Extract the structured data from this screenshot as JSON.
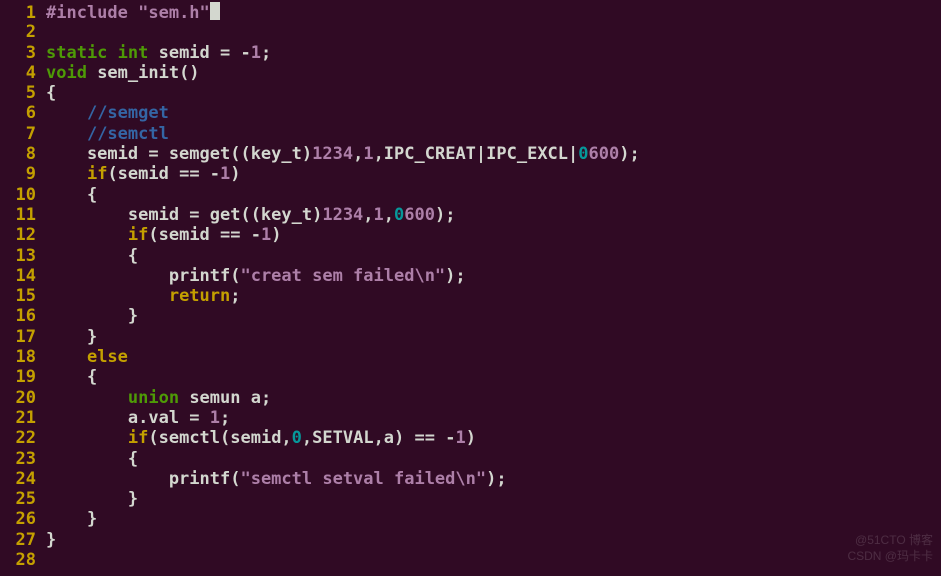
{
  "editor": {
    "lines": [
      {
        "n": 1,
        "tokens": [
          {
            "c": "preproc",
            "t": "#include "
          },
          {
            "c": "string",
            "t": "\"sem.h\""
          },
          {
            "cursor": true
          }
        ]
      },
      {
        "n": 2,
        "tokens": []
      },
      {
        "n": 3,
        "tokens": [
          {
            "c": "type",
            "t": "static int"
          },
          {
            "c": "default",
            "t": " semid = -"
          },
          {
            "c": "number",
            "t": "1"
          },
          {
            "c": "default",
            "t": ";"
          }
        ]
      },
      {
        "n": 4,
        "tokens": [
          {
            "c": "type",
            "t": "void"
          },
          {
            "c": "default",
            "t": " sem_init()"
          }
        ]
      },
      {
        "n": 5,
        "tokens": [
          {
            "c": "default",
            "t": "{"
          }
        ]
      },
      {
        "n": 6,
        "tokens": [
          {
            "c": "default",
            "t": "    "
          },
          {
            "c": "comment",
            "t": "//semget"
          }
        ]
      },
      {
        "n": 7,
        "tokens": [
          {
            "c": "default",
            "t": "    "
          },
          {
            "c": "comment",
            "t": "//semctl"
          }
        ]
      },
      {
        "n": 8,
        "tokens": [
          {
            "c": "default",
            "t": "    semid = semget((key_t)"
          },
          {
            "c": "number",
            "t": "1234"
          },
          {
            "c": "default",
            "t": ","
          },
          {
            "c": "number",
            "t": "1"
          },
          {
            "c": "default",
            "t": ",IPC_CREAT|IPC_EXCL|"
          },
          {
            "c": "zero",
            "t": "0"
          },
          {
            "c": "number",
            "t": "600"
          },
          {
            "c": "default",
            "t": ");"
          }
        ]
      },
      {
        "n": 9,
        "tokens": [
          {
            "c": "default",
            "t": "    "
          },
          {
            "c": "keyword",
            "t": "if"
          },
          {
            "c": "default",
            "t": "(semid == -"
          },
          {
            "c": "number",
            "t": "1"
          },
          {
            "c": "default",
            "t": ")"
          }
        ]
      },
      {
        "n": 10,
        "tokens": [
          {
            "c": "default",
            "t": "    {"
          }
        ]
      },
      {
        "n": 11,
        "tokens": [
          {
            "c": "default",
            "t": "        semid = get((key_t)"
          },
          {
            "c": "number",
            "t": "1234"
          },
          {
            "c": "default",
            "t": ","
          },
          {
            "c": "number",
            "t": "1"
          },
          {
            "c": "default",
            "t": ","
          },
          {
            "c": "zero",
            "t": "0"
          },
          {
            "c": "number",
            "t": "600"
          },
          {
            "c": "default",
            "t": ");"
          }
        ]
      },
      {
        "n": 12,
        "tokens": [
          {
            "c": "default",
            "t": "        "
          },
          {
            "c": "keyword",
            "t": "if"
          },
          {
            "c": "default",
            "t": "(semid == -"
          },
          {
            "c": "number",
            "t": "1"
          },
          {
            "c": "default",
            "t": ")"
          }
        ]
      },
      {
        "n": 13,
        "tokens": [
          {
            "c": "default",
            "t": "        {"
          }
        ]
      },
      {
        "n": 14,
        "tokens": [
          {
            "c": "default",
            "t": "            printf("
          },
          {
            "c": "string",
            "t": "\"creat sem failed\\n\""
          },
          {
            "c": "default",
            "t": ");"
          }
        ]
      },
      {
        "n": 15,
        "tokens": [
          {
            "c": "default",
            "t": "            "
          },
          {
            "c": "keyword",
            "t": "return"
          },
          {
            "c": "default",
            "t": ";"
          }
        ]
      },
      {
        "n": 16,
        "tokens": [
          {
            "c": "default",
            "t": "        }"
          }
        ]
      },
      {
        "n": 17,
        "tokens": [
          {
            "c": "default",
            "t": "    }"
          }
        ]
      },
      {
        "n": 18,
        "tokens": [
          {
            "c": "default",
            "t": "    "
          },
          {
            "c": "keyword",
            "t": "else"
          }
        ]
      },
      {
        "n": 19,
        "tokens": [
          {
            "c": "default",
            "t": "    {"
          }
        ]
      },
      {
        "n": 20,
        "tokens": [
          {
            "c": "default",
            "t": "        "
          },
          {
            "c": "type",
            "t": "union"
          },
          {
            "c": "default",
            "t": " semun a;"
          }
        ]
      },
      {
        "n": 21,
        "tokens": [
          {
            "c": "default",
            "t": "        a.val = "
          },
          {
            "c": "number",
            "t": "1"
          },
          {
            "c": "default",
            "t": ";"
          }
        ]
      },
      {
        "n": 22,
        "tokens": [
          {
            "c": "default",
            "t": "        "
          },
          {
            "c": "keyword",
            "t": "if"
          },
          {
            "c": "default",
            "t": "(semctl(semid,"
          },
          {
            "c": "zero",
            "t": "0"
          },
          {
            "c": "default",
            "t": ",SETVAL,a) == -"
          },
          {
            "c": "number",
            "t": "1"
          },
          {
            "c": "default",
            "t": ")"
          }
        ]
      },
      {
        "n": 23,
        "tokens": [
          {
            "c": "default",
            "t": "        {"
          }
        ]
      },
      {
        "n": 24,
        "tokens": [
          {
            "c": "default",
            "t": "            printf("
          },
          {
            "c": "string",
            "t": "\"semctl setval failed\\n\""
          },
          {
            "c": "default",
            "t": ");"
          }
        ]
      },
      {
        "n": 25,
        "tokens": [
          {
            "c": "default",
            "t": "        }"
          }
        ]
      },
      {
        "n": 26,
        "tokens": [
          {
            "c": "default",
            "t": "    }"
          }
        ]
      },
      {
        "n": 27,
        "tokens": [
          {
            "c": "default",
            "t": "}"
          }
        ]
      },
      {
        "n": 28,
        "tokens": []
      }
    ]
  },
  "watermarks": {
    "w1": "@51CTO 博客",
    "w2": "CSDN @玛卡卡"
  }
}
